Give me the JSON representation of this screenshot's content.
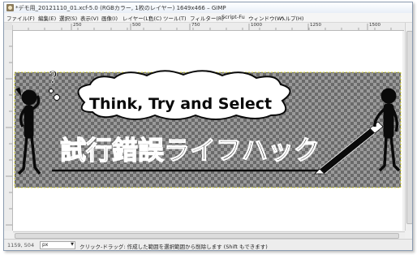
{
  "window": {
    "title": "*デモ用_20121110_01.xcf-5.0 (RGBカラー, 1枚のレイヤー) 1649x466 – GIMP"
  },
  "menu": [
    "ファイル(F)",
    "編集(E)",
    "選択(S)",
    "表示(V)",
    "画像(I)",
    "レイヤー(L)",
    "色(C)",
    "ツール(T)",
    "フィルター(R)",
    "Script-Fu",
    "ウィンドウ(W)",
    "ヘルプ(H)"
  ],
  "ruler": {
    "labels": [
      "250",
      "500",
      "750",
      "1000",
      "1250",
      "1500"
    ]
  },
  "canvas": {
    "heading": "Think, Try and Select",
    "banner_text": "試行錯誤ライフハック",
    "thought_mark": "?"
  },
  "status": {
    "coords": "1159, 504",
    "unit": "px",
    "message": "クリック-ドラッグ: 作成した範囲を選択範囲から削除します (Shift もできます)"
  }
}
